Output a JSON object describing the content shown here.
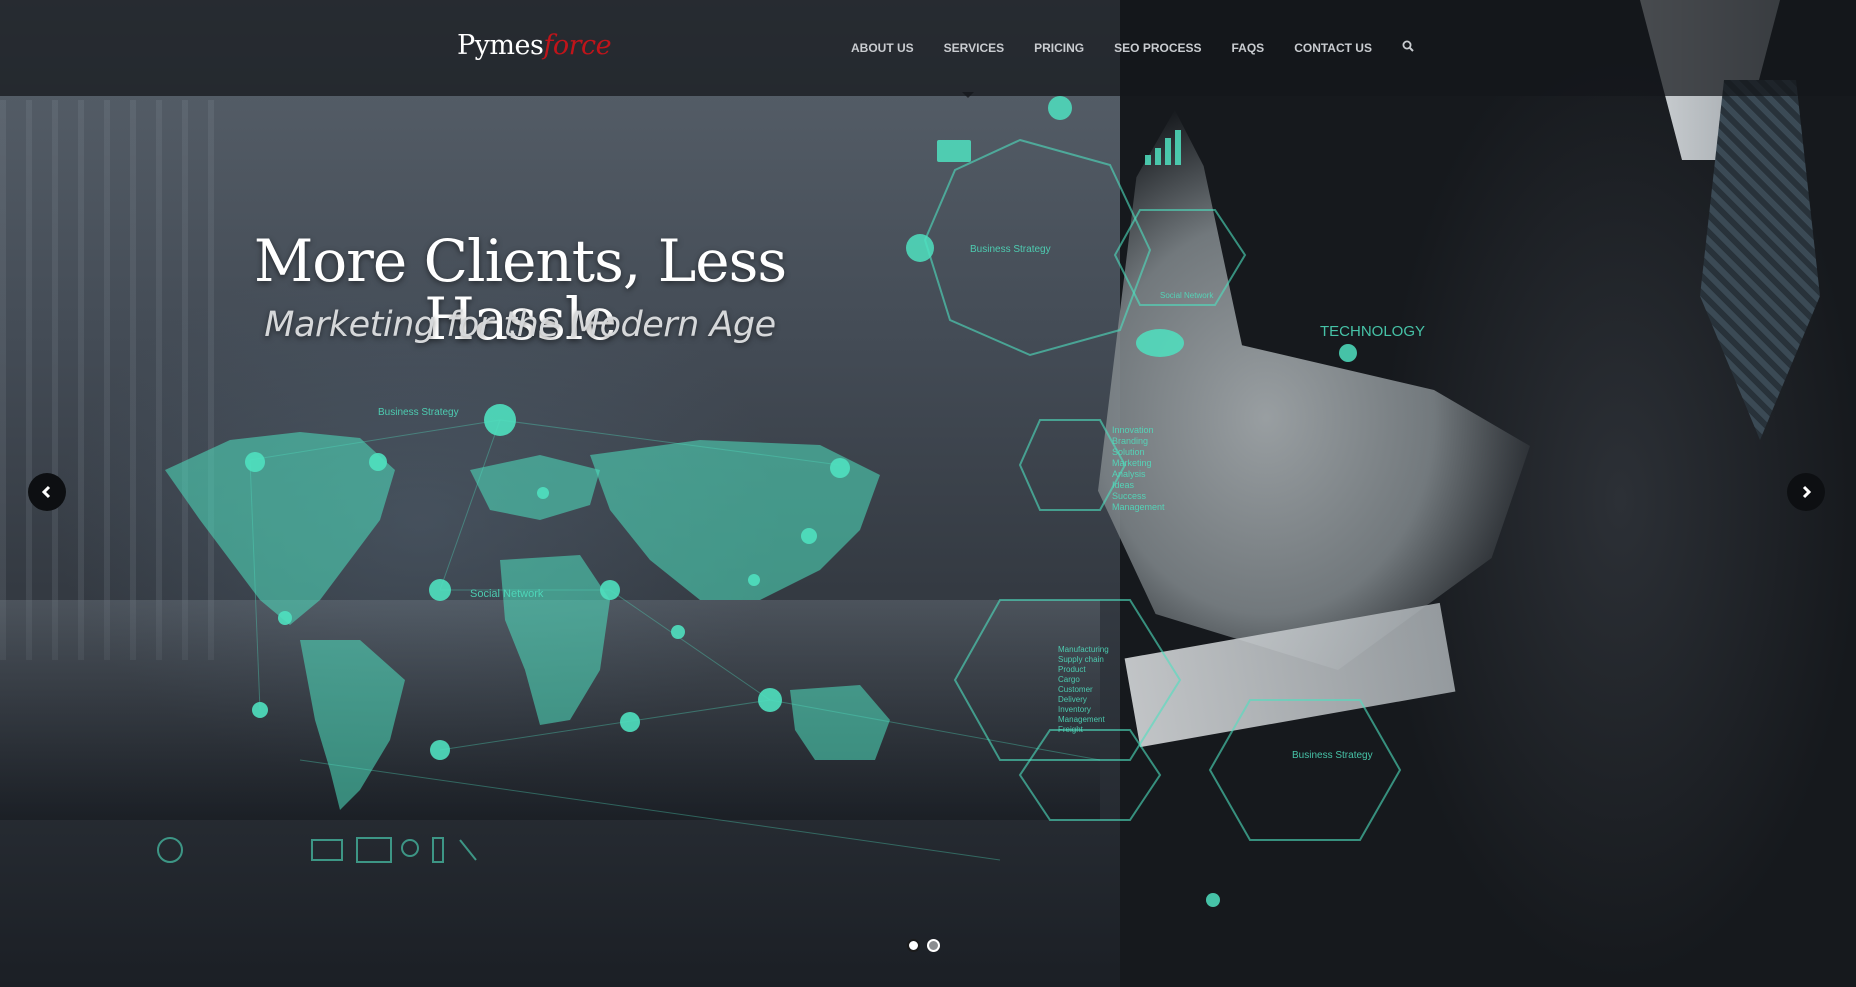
{
  "brand": {
    "logo_part1": "Pymes",
    "logo_part2": "force",
    "accent_color": "#c0141a"
  },
  "nav": {
    "items": [
      {
        "label": "ABOUT US"
      },
      {
        "label": "SERVICES"
      },
      {
        "label": "PRICING"
      },
      {
        "label": "SEO PROCESS"
      },
      {
        "label": "FAQS"
      },
      {
        "label": "CONTACT US"
      }
    ],
    "search_icon": "search-icon"
  },
  "hero": {
    "headline": "More Clients, Less Hassle",
    "subheadline": "Marketing for the Modern Age",
    "holo_color": "#4fe0bf",
    "overlay_labels": {
      "business_strategy_top": "Business Strategy",
      "business_strategy_map": "Business Strategy",
      "social_network_map": "Social Network",
      "social_network_hex": "Social Network",
      "technology": "TECHNOLOGY",
      "business_strategy_bottom": "Business Strategy",
      "service_list": [
        "Innovation",
        "Branding",
        "Solution",
        "Marketing",
        "Analysis",
        "Ideas",
        "Success",
        "Management"
      ],
      "supply_list": [
        "Manufacturing",
        "Supply chain",
        "Product",
        "Cargo",
        "Customer",
        "Delivery",
        "Inventory",
        "Management",
        "Freight"
      ]
    }
  },
  "slider": {
    "prev_icon": "chevron-left-icon",
    "next_icon": "chevron-right-icon",
    "slide_count": 2,
    "active_index": 0
  }
}
